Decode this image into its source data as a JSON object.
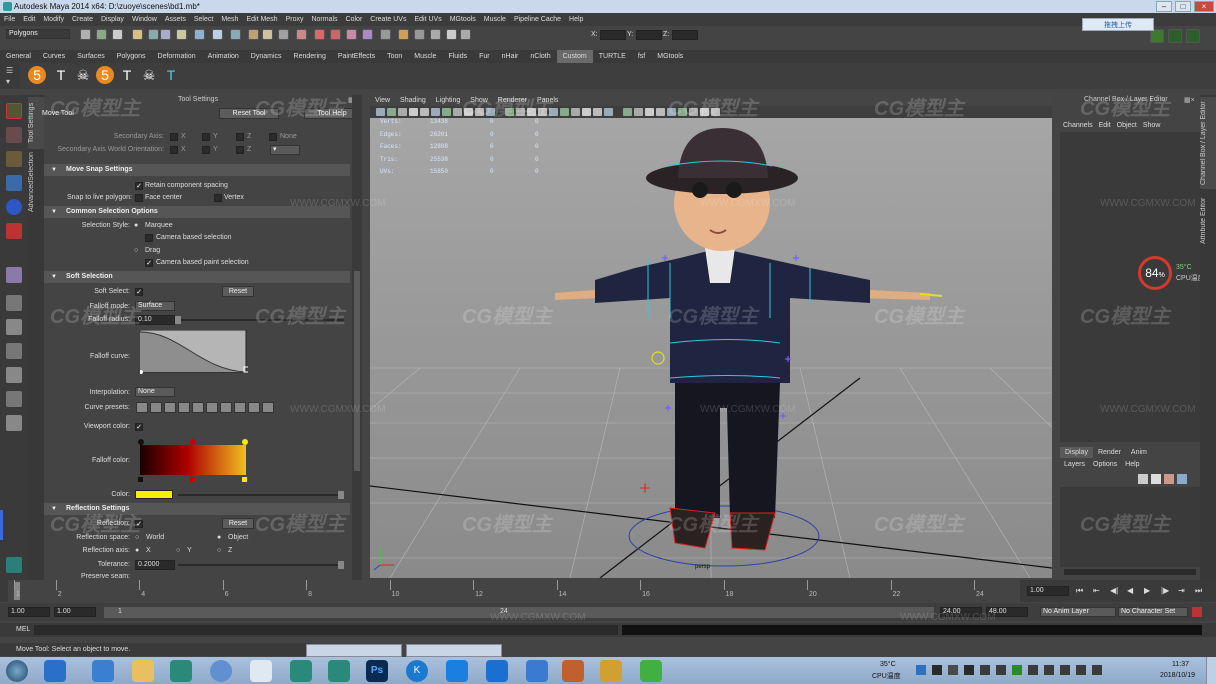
{
  "window": {
    "title": "Autodesk Maya 2014 x64: D:\\zuoye\\scenes\\bd1.mb*"
  },
  "menus": [
    "File",
    "Edit",
    "Modify",
    "Create",
    "Display",
    "Window",
    "Assets",
    "Select",
    "Mesh",
    "Edit Mesh",
    "Proxy",
    "Normals",
    "Color",
    "Create UVs",
    "Edit UVs",
    "MGtools",
    "Muscle",
    "Pipeline Cache",
    "Help"
  ],
  "toolbar": {
    "mode": "Polygons",
    "x_label": "X:",
    "y_label": "Y:",
    "z_label": "Z:"
  },
  "cloud_button": "拖拽上传",
  "shelf_tabs": [
    "General",
    "Curves",
    "Surfaces",
    "Polygons",
    "Deformation",
    "Animation",
    "Dynamics",
    "Rendering",
    "PaintEffects",
    "Toon",
    "Muscle",
    "Fluids",
    "Fur",
    "nHair",
    "nCloth",
    "Custom",
    "TURTLE",
    "fsf",
    "MGtools"
  ],
  "shelf_selected": "Custom",
  "shelf_icons": [
    {
      "glyph": "5",
      "name": "script5-icon"
    },
    {
      "glyph": "T",
      "name": "tpose-icon"
    },
    {
      "glyph": "☠",
      "name": "skull-icon"
    },
    {
      "glyph": "5",
      "name": "script5b-icon"
    },
    {
      "glyph": "T",
      "name": "tpose2-icon"
    },
    {
      "glyph": "☠",
      "name": "skull2-icon"
    },
    {
      "glyph": "T",
      "name": "tpose3-icon"
    }
  ],
  "side_tabs": [
    "Tool Settings",
    "AdvancedSelection"
  ],
  "tool_settings": {
    "panel_title": "Tool Settings",
    "tool_name": "Move Tool",
    "reset_tool": "Reset Tool",
    "tool_help": "Tool Help",
    "secondary_axis": "Secondary Axis:",
    "secondary_axis_world": "Secondary Axis World Orientation:",
    "axes": [
      "X",
      "Y",
      "Z"
    ],
    "none_label": "None",
    "move_snap": {
      "header": "Move Snap Settings",
      "retain": "Retain component spacing",
      "snap_label": "Snap to live polygon:",
      "face_center": "Face center",
      "vertex": "Vertex"
    },
    "common_selection": {
      "header": "Common Selection Options",
      "style_label": "Selection Style:",
      "marquee": "Marquee",
      "camera_based": "Camera based selection",
      "drag": "Drag",
      "camera_paint": "Camera based paint selection"
    },
    "soft_selection": {
      "header": "Soft Selection",
      "soft_select": "Soft Select:",
      "reset": "Reset",
      "falloff_mode": "Falloff mode:",
      "falloff_mode_value": "Surface",
      "falloff_radius": "Falloff radius:",
      "falloff_radius_value": "0.10",
      "falloff_curve": "Falloff curve:",
      "interpolation": "Interpolation:",
      "interpolation_value": "None",
      "curve_presets": "Curve presets:",
      "viewport_color": "Viewport color:",
      "falloff_color": "Falloff color:",
      "color": "Color:",
      "color_value": "#f6f000"
    },
    "reflection": {
      "header": "Reflection Settings",
      "reflection": "Reflection:",
      "reset": "Reset",
      "space_label": "Reflection space:",
      "world": "World",
      "object": "Object",
      "axis_label": "Reflection axis:",
      "x": "X",
      "y": "Y",
      "z": "Z",
      "tolerance_label": "Tolerance:",
      "tolerance_value": "0.2000",
      "preserve": "Preserve seam:"
    }
  },
  "viewport": {
    "menu": [
      "View",
      "Shading",
      "Lighting",
      "Show",
      "Renderer",
      "Panels"
    ],
    "hud": [
      {
        "label": "Verts:",
        "a": "13438",
        "b": "0",
        "c": "0"
      },
      {
        "label": "Edges:",
        "a": "26201",
        "b": "0",
        "c": "0"
      },
      {
        "label": "Faces:",
        "a": "12808",
        "b": "0",
        "c": "0"
      },
      {
        "label": "Tris:",
        "a": "25538",
        "b": "0",
        "c": "0"
      },
      {
        "label": "UVs:",
        "a": "15850",
        "b": "0",
        "c": "0"
      }
    ],
    "camera": "persp"
  },
  "channel_box": {
    "title": "Channel Box / Layer Editor",
    "menu": [
      "Channels",
      "Edit",
      "Object",
      "Show"
    ],
    "layer_tabs": [
      "Display",
      "Render",
      "Anim"
    ],
    "layer_menu": [
      "Layers",
      "Options",
      "Help"
    ],
    "cpu_percent": "84",
    "cpu_unit": "%",
    "cpu_temp": "35°C",
    "cpu_label": "CPU温度",
    "side_tabs": [
      "Channel Box / Layer Editor",
      "Attribute Editor"
    ]
  },
  "timeline": {
    "ticks": [
      "1",
      "2",
      "4",
      "6",
      "8",
      "10",
      "12",
      "14",
      "16",
      "18",
      "20",
      "22",
      "24"
    ],
    "current_frame": "1.00"
  },
  "range": {
    "start": "1.00",
    "inner_start": "1.00",
    "slider_start": "1",
    "slider_end": "24",
    "inner_end": "24.00",
    "end": "48.00",
    "anim_layer": "No Anim Layer",
    "character_set": "No Character Set"
  },
  "mel": {
    "label": "MEL"
  },
  "help_line": "Move Tool: Select an object to move.",
  "taskbar": {
    "temp": "35°C",
    "cpu_label": "CPU温度",
    "time": "11:37",
    "date": "2018/10/19",
    "ps_label": "Ps",
    "k_label": "K"
  },
  "watermarks": {
    "logo": "CG模型主",
    "url": "WWW.CGMXW.COM"
  }
}
